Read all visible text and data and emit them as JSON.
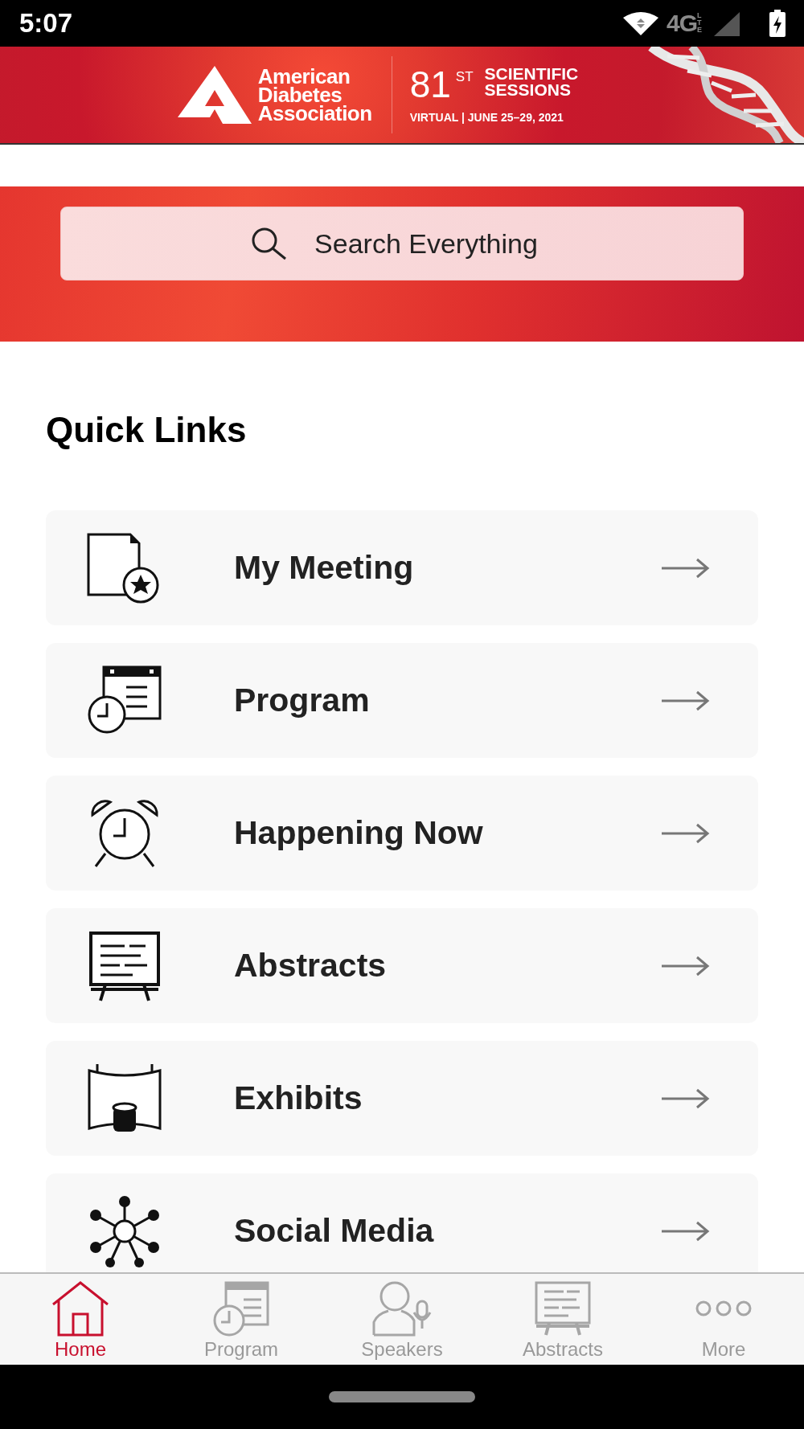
{
  "status_bar": {
    "time": "5:07",
    "network": "4G",
    "network_sub": "LTE"
  },
  "banner": {
    "org": [
      "American",
      "Diabetes",
      "Association"
    ],
    "edition": "81",
    "edition_suffix": "ST",
    "event": [
      "SCIENTIFIC",
      "SESSIONS"
    ],
    "dates": "VIRTUAL | JUNE 25–29, 2021"
  },
  "search": {
    "placeholder": "Search Everything"
  },
  "quick_links": {
    "title": "Quick Links",
    "items": [
      {
        "label": "My Meeting"
      },
      {
        "label": "Program"
      },
      {
        "label": "Happening Now"
      },
      {
        "label": "Abstracts"
      },
      {
        "label": "Exhibits"
      },
      {
        "label": "Social Media"
      }
    ]
  },
  "tab_bar": [
    {
      "label": "Home",
      "selected": true
    },
    {
      "label": "Program",
      "selected": false
    },
    {
      "label": "Speakers",
      "selected": false
    },
    {
      "label": "Abstracts",
      "selected": false
    },
    {
      "label": "More",
      "selected": false
    }
  ]
}
